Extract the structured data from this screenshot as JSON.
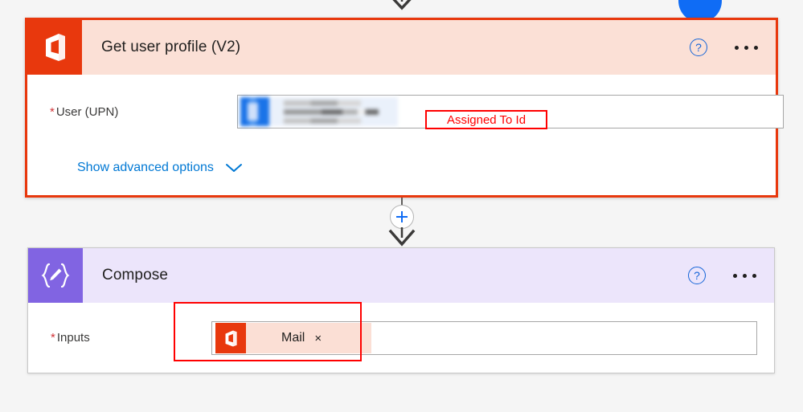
{
  "canvas": {
    "background_color": "#f5f5f5"
  },
  "top": {
    "arrow_icon": "arrow-down-icon",
    "blue_circle_icon": "blue-circle-node"
  },
  "cards": [
    {
      "id": "get-user-profile",
      "title": "Get user profile (V2)",
      "icon_name": "office365-users-icon",
      "icon_bg": "#e8380d",
      "header_bg": "#fbe0d6",
      "selected_border_color": "#e8380d",
      "help_label": "?",
      "more_label": "More commands",
      "fields": [
        {
          "required_marker": "*",
          "label": "User (UPN)",
          "value_token": "redacted-user-token",
          "annotation": "Assigned To Id"
        }
      ],
      "advanced_options_label": "Show advanced options",
      "chevron_icon": "chevron-down-icon"
    },
    {
      "id": "compose",
      "title": "Compose",
      "icon_name": "compose-braces-pencil-icon",
      "icon_bg": "#8164e2",
      "header_bg": "#ece5fb",
      "help_label": "?",
      "more_label": "More commands",
      "fields": [
        {
          "required_marker": "*",
          "label": "Inputs",
          "token_label": "Mail",
          "token_icon": "office365-icon",
          "token_remove_label": "×"
        }
      ]
    }
  ],
  "connector": {
    "add_step_label": "+",
    "add_step_icon": "plus-icon",
    "arrow_icon": "arrow-down-icon"
  }
}
